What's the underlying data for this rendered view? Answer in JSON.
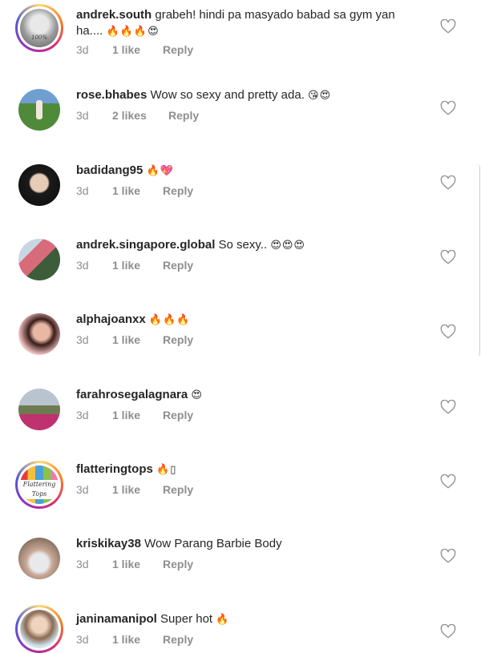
{
  "comments": [
    {
      "username": "andrek.south",
      "text": "grabeh! hindi pa masyado babad sa gym yan",
      "text2": "ha....",
      "emoji": "🔥🔥🔥😍",
      "time": "3d",
      "likes": "1 like",
      "reply": "Reply",
      "avatar_text": "100%"
    },
    {
      "username": "rose.bhabes",
      "text": "Wow so sexy and pretty ada.",
      "emoji": "😘😍",
      "time": "3d",
      "likes": "2 likes",
      "reply": "Reply"
    },
    {
      "username": "badidang95",
      "text": "",
      "emoji": "🔥💖",
      "time": "3d",
      "likes": "1 like",
      "reply": "Reply"
    },
    {
      "username": "andrek.singapore.global",
      "text": "So sexy..",
      "emoji": "😍😍😍",
      "time": "3d",
      "likes": "1 like",
      "reply": "Reply"
    },
    {
      "username": "alphajoanxx",
      "text": "",
      "emoji": "🔥🔥🔥",
      "time": "3d",
      "likes": "1 like",
      "reply": "Reply"
    },
    {
      "username": "farahrosegalagnara",
      "text": "",
      "emoji": "😍",
      "time": "3d",
      "likes": "1 like",
      "reply": "Reply"
    },
    {
      "username": "flatteringtops",
      "text": "",
      "emoji": "🔥▯",
      "time": "3d",
      "likes": "1 like",
      "reply": "Reply",
      "avatar_text": "Flattering Tops"
    },
    {
      "username": "kriskikay38",
      "text": "Wow Parang Barbie Body",
      "emoji": "",
      "time": "3d",
      "likes": "1 like",
      "reply": "Reply"
    },
    {
      "username": "janinamanipol",
      "text": "Super hot",
      "emoji": "🔥",
      "time": "3d",
      "likes": "1 like",
      "reply": "Reply"
    }
  ],
  "icons": {
    "heart": "heart-outline-icon"
  },
  "colors": {
    "text": "#262626",
    "meta": "#8e8e8e",
    "story_ring": "#d62976"
  }
}
